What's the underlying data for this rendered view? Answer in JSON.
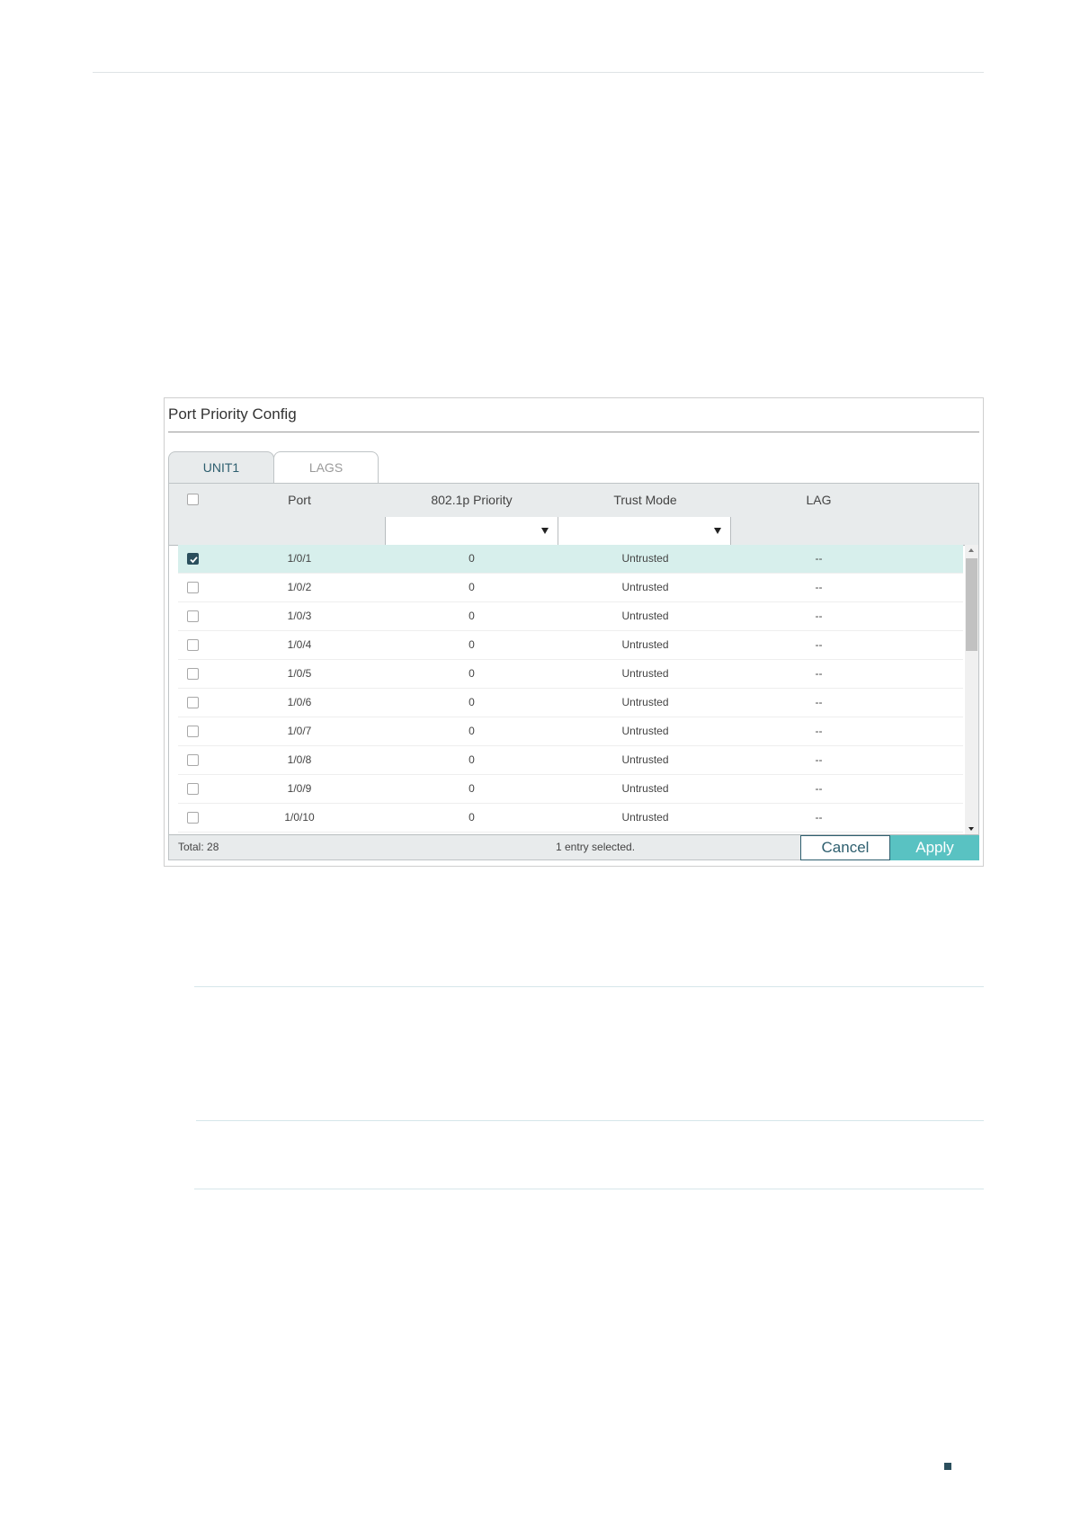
{
  "panel": {
    "title": "Port Priority Config"
  },
  "tabs": [
    {
      "label": "UNIT1",
      "active": true
    },
    {
      "label": "LAGS",
      "active": false
    }
  ],
  "columns": {
    "port": "Port",
    "priority": "802.1p Priority",
    "trust": "Trust Mode",
    "lag": "LAG"
  },
  "filters": {
    "priority": "",
    "trust": ""
  },
  "rows": [
    {
      "port": "1/0/1",
      "priority": "0",
      "trust": "Untrusted",
      "lag": "--",
      "checked": true
    },
    {
      "port": "1/0/2",
      "priority": "0",
      "trust": "Untrusted",
      "lag": "--",
      "checked": false
    },
    {
      "port": "1/0/3",
      "priority": "0",
      "trust": "Untrusted",
      "lag": "--",
      "checked": false
    },
    {
      "port": "1/0/4",
      "priority": "0",
      "trust": "Untrusted",
      "lag": "--",
      "checked": false
    },
    {
      "port": "1/0/5",
      "priority": "0",
      "trust": "Untrusted",
      "lag": "--",
      "checked": false
    },
    {
      "port": "1/0/6",
      "priority": "0",
      "trust": "Untrusted",
      "lag": "--",
      "checked": false
    },
    {
      "port": "1/0/7",
      "priority": "0",
      "trust": "Untrusted",
      "lag": "--",
      "checked": false
    },
    {
      "port": "1/0/8",
      "priority": "0",
      "trust": "Untrusted",
      "lag": "--",
      "checked": false
    },
    {
      "port": "1/0/9",
      "priority": "0",
      "trust": "Untrusted",
      "lag": "--",
      "checked": false
    },
    {
      "port": "1/0/10",
      "priority": "0",
      "trust": "Untrusted",
      "lag": "--",
      "checked": false
    }
  ],
  "footer": {
    "total": "Total: 28",
    "selected": "1 entry selected."
  },
  "buttons": {
    "cancel": "Cancel",
    "apply": "Apply"
  },
  "colors": {
    "accent": "#59c2c2",
    "selected_row": "#d7efec",
    "dark": "#2b4f5d"
  }
}
